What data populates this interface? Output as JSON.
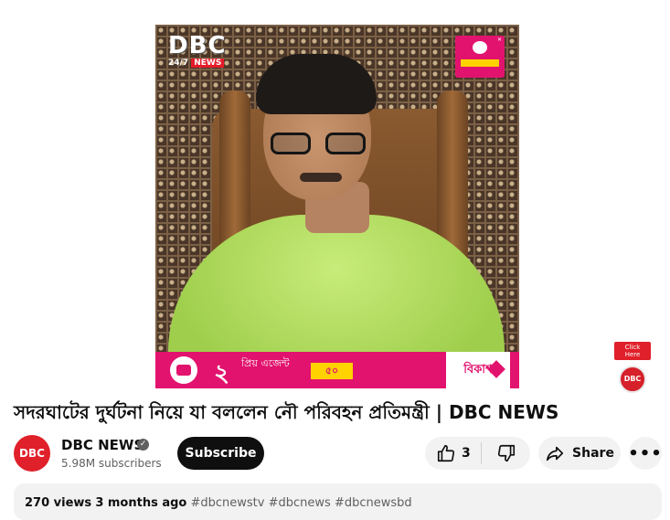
{
  "video": {
    "logo_text": "DBC",
    "logo_sub_247": "24/7",
    "logo_sub_news": "NEWS",
    "banner_number": "২",
    "banner_text": "প্রিয় এজেন্ট",
    "banner_strip": "৫০",
    "banner_brand": "বিকাশ"
  },
  "ad_badge": {
    "label": "Click Here",
    "logo": "DBC"
  },
  "title": "সদরঘাটের দুর্ঘটনা নিয়ে যা বললেন নৌ পরিবহন প্রতিমন্ত্রী | DBC NEWS",
  "channel": {
    "avatar_text": "DBC",
    "name": "DBC NEWS",
    "subscribers": "5.98M subscribers",
    "subscribe_label": "Subscribe"
  },
  "actions": {
    "like_count": "3",
    "share_label": "Share",
    "more_label": "•••"
  },
  "description": {
    "views": "270 views",
    "age": "3 months ago",
    "hashtags": "#dbcnewstv #dbcnews #dbcnewsbd"
  },
  "colors": {
    "brand_red": "#e0202a",
    "bkash_pink": "#e2136e",
    "shirt_green": "#b8e26a"
  }
}
